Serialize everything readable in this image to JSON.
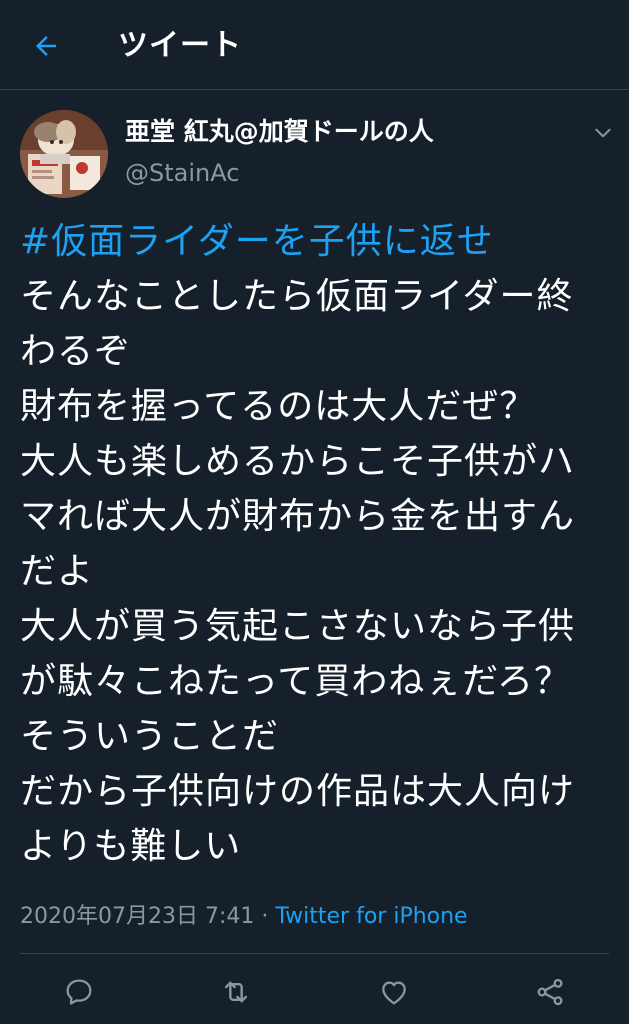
{
  "header": {
    "title": "ツイート",
    "back_icon": "arrow-left-icon"
  },
  "tweet": {
    "display_name": "亜堂 紅丸@加賀ドールの人",
    "handle": "@StainAc",
    "hashtag": "#仮面ライダーを子供に返せ",
    "lines": [
      "そんなことしたら仮面ライダー終",
      "わるぞ",
      "財布を握ってるのは大人だぜ？",
      "大人も楽しめるからこそ子供がハ",
      "マれば大人が財布から金を出すん",
      "だよ",
      "大人が買う気起こさないなら子供",
      "が駄々こねたって買わねぇだろ？",
      "そういうことだ",
      "だから子供向けの作品は大人向け",
      "よりも難しい"
    ],
    "timestamp": "2020年07月23日 7:41",
    "separator": " · ",
    "source": "Twitter for iPhone"
  },
  "actions": {
    "reply_icon": "reply-icon",
    "retweet_icon": "retweet-icon",
    "like_icon": "heart-icon",
    "share_icon": "share-icon"
  },
  "colors": {
    "background": "#15202b",
    "accent": "#1da1f2",
    "secondary_text": "#8899a6",
    "divider": "#38444d"
  }
}
